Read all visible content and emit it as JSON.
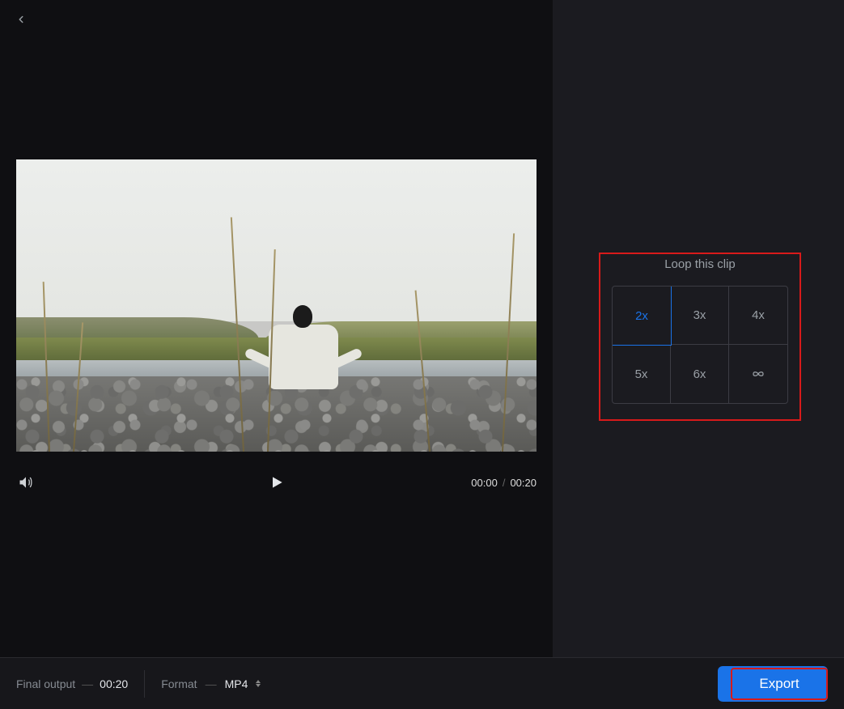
{
  "loop": {
    "title": "Loop this clip",
    "options": [
      "2x",
      "3x",
      "4x",
      "5x",
      "6x",
      "∞"
    ],
    "selected": "2x"
  },
  "playback": {
    "current_time": "00:00",
    "total_time": "00:20"
  },
  "footer": {
    "final_output_label": "Final output",
    "final_output_value": "00:20",
    "format_label": "Format",
    "format_value": "MP4",
    "export_label": "Export"
  }
}
